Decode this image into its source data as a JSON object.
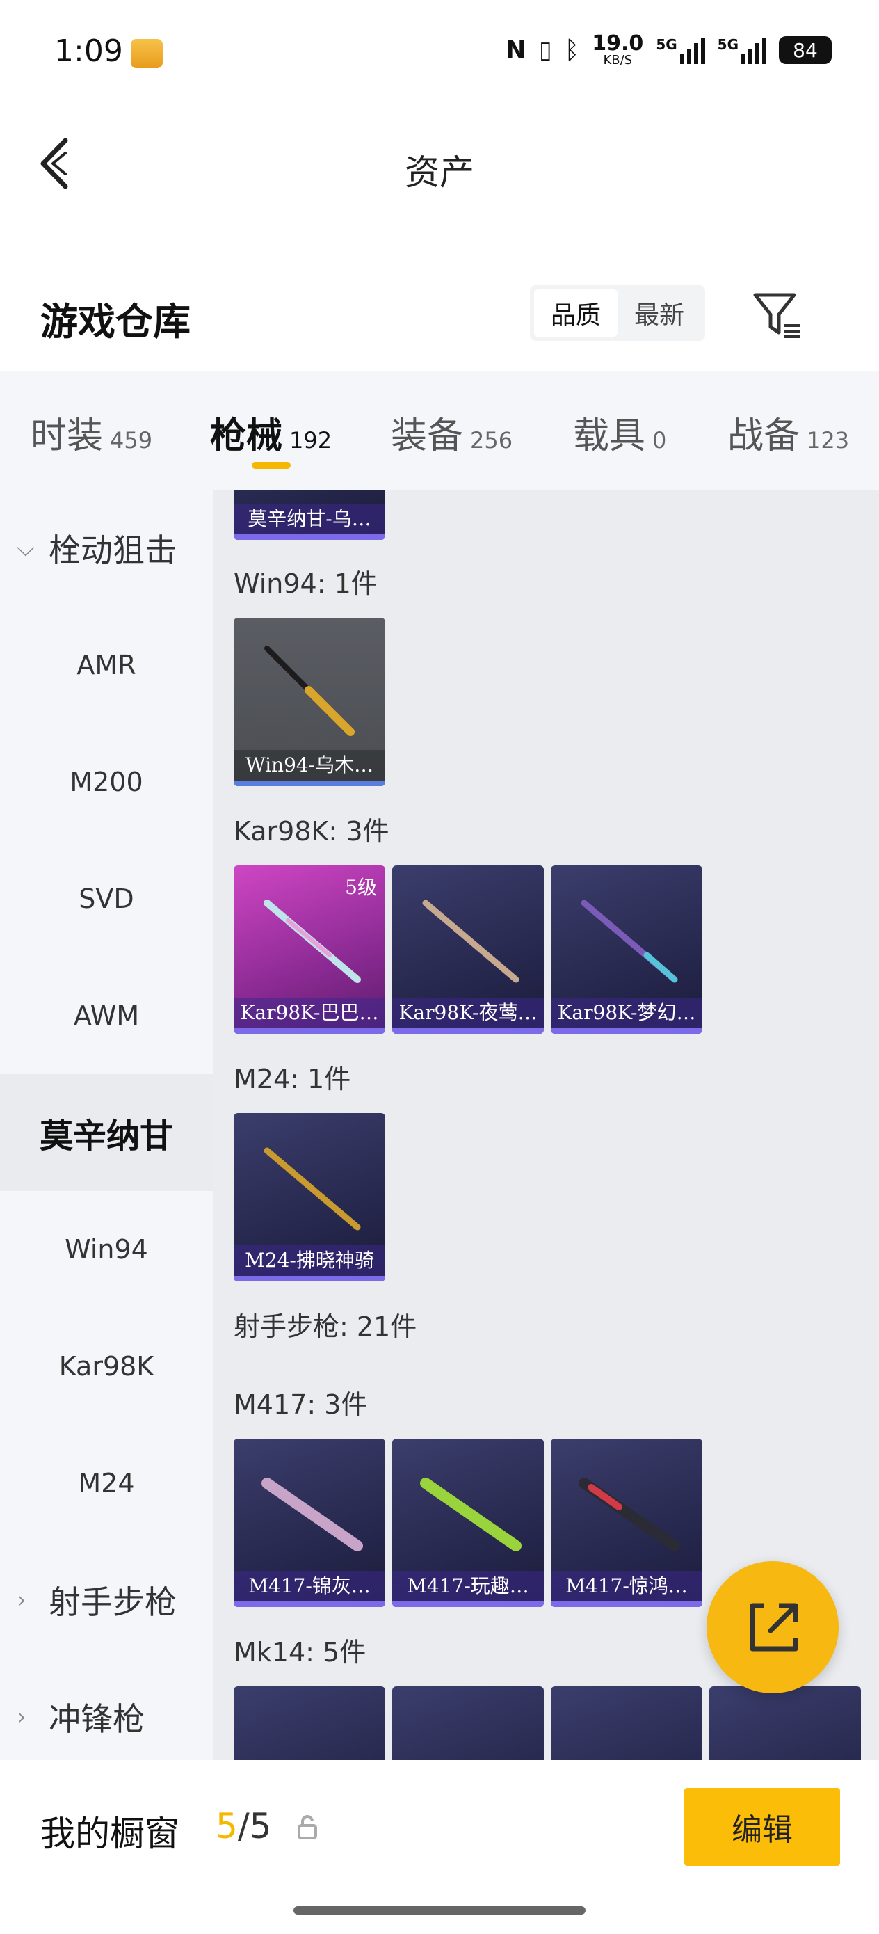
{
  "status": {
    "time": "1:09",
    "net_speed": "19.0",
    "net_unit": "KB/S",
    "sig1": "5G",
    "sig2": "5G",
    "battery": "84"
  },
  "header": {
    "title": "资产"
  },
  "section": {
    "title": "游戏仓库",
    "sort_quality": "品质",
    "sort_newest": "最新"
  },
  "tabs": [
    {
      "label": "时装",
      "count": "459"
    },
    {
      "label": "枪械",
      "count": "192"
    },
    {
      "label": "装备",
      "count": "256"
    },
    {
      "label": "载具",
      "count": "0"
    },
    {
      "label": "战备",
      "count": "123"
    }
  ],
  "sidebar": [
    {
      "label": "栓动狙击",
      "type": "group-open"
    },
    {
      "label": "AMR"
    },
    {
      "label": "M200"
    },
    {
      "label": "SVD"
    },
    {
      "label": "AWM"
    },
    {
      "label": "莫辛纳甘",
      "type": "selected"
    },
    {
      "label": "Win94"
    },
    {
      "label": "Kar98K"
    },
    {
      "label": "M24"
    },
    {
      "label": "射手步枪",
      "type": "group-closed"
    },
    {
      "label": "冲锋枪",
      "type": "group-closed"
    }
  ],
  "content": {
    "top_card": "莫辛纳甘-乌…",
    "groups": [
      {
        "label": "Win94: 1件",
        "items": [
          {
            "name": "Win94-乌木…",
            "style": "grey"
          }
        ]
      },
      {
        "label": "Kar98K: 3件",
        "items": [
          {
            "name": "Kar98K-巴巴…",
            "style": "pink",
            "level": "5级"
          },
          {
            "name": "Kar98K-夜莺…"
          },
          {
            "name": "Kar98K-梦幻…"
          }
        ]
      },
      {
        "label": "M24: 1件",
        "items": [
          {
            "name": "M24-拂晓神骑"
          }
        ]
      },
      {
        "label": "射手步枪: 21件"
      },
      {
        "label": "M417: 3件",
        "items": [
          {
            "name": "M417-锦灰…"
          },
          {
            "name": "M417-玩趣…"
          },
          {
            "name": "M417-惊鸿…"
          }
        ]
      },
      {
        "label": "Mk14: 5件"
      }
    ]
  },
  "bottom": {
    "window_label": "我的橱窗",
    "count_current": "5",
    "count_total": "/5",
    "edit": "编辑"
  },
  "colors": {
    "accent": "#f5b800",
    "fab": "#f8b812",
    "card_purple": "#2e3060",
    "card_pink": "#b73cb4"
  }
}
